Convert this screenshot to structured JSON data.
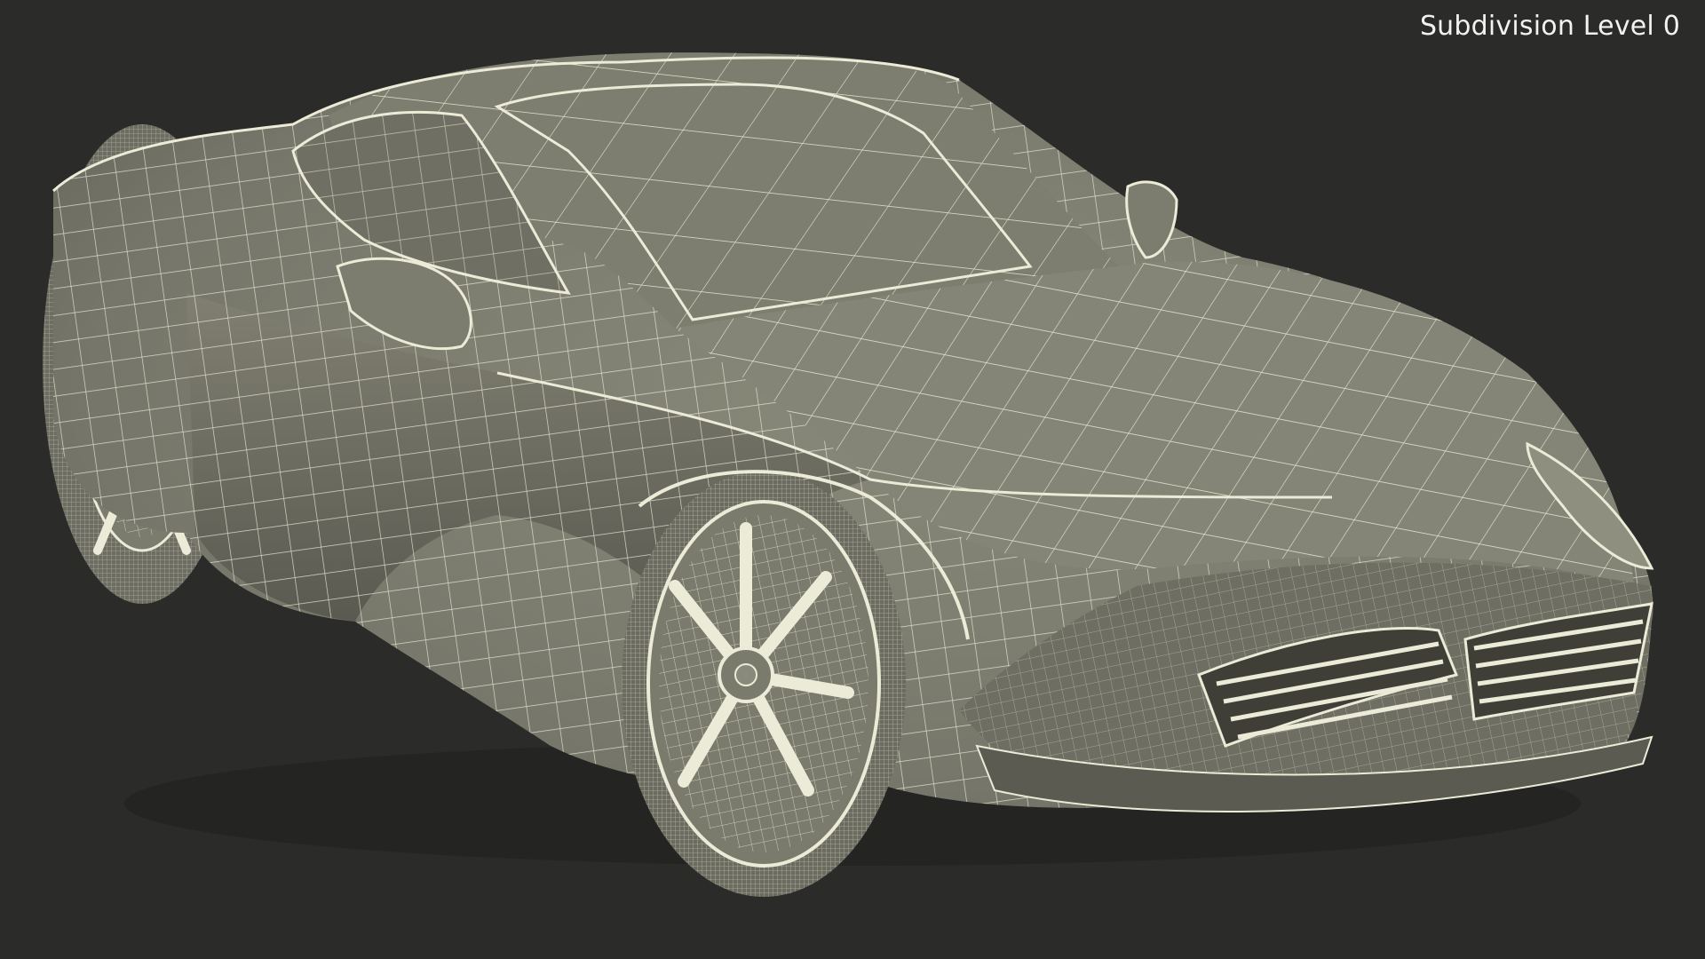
{
  "viewport": {
    "overlay_label": "Subdivision Level 0",
    "background_color": "#2b2b2a",
    "model": {
      "subject": "sports-car-wireframe-icon",
      "surface_color": "#7a7a6c",
      "wire_color": "#ecebd7",
      "shadow_color": "#505046"
    }
  }
}
